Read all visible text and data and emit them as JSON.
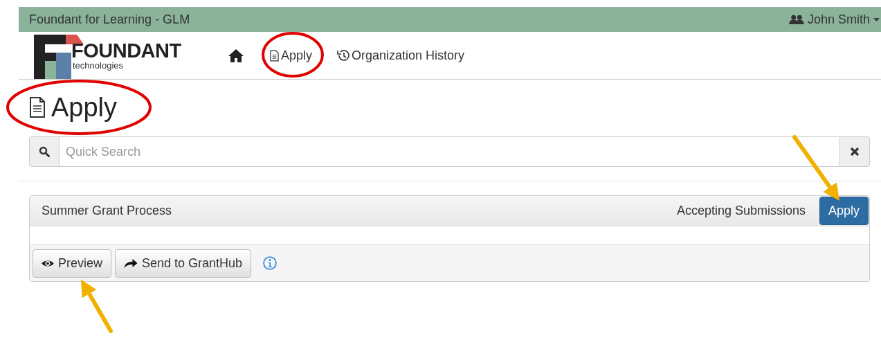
{
  "app_bar": {
    "title": "Foundant for Learning - GLM",
    "user": "John Smith"
  },
  "logo": {
    "name": "FOUNDANT",
    "tagline": "technologies"
  },
  "nav": [
    {
      "kind": "home"
    },
    {
      "kind": "document",
      "label": "Apply"
    },
    {
      "kind": "history",
      "label": "Organization History"
    }
  ],
  "page_title": "Apply",
  "search": {
    "placeholder": "Quick Search"
  },
  "processes": [
    {
      "name": "Summer Grant Process",
      "status": "Accepting Submissions",
      "action": "Apply",
      "buttons": [
        {
          "kind": "preview",
          "label": "Preview"
        },
        {
          "kind": "send",
          "label": "Send to GrantHub"
        }
      ]
    }
  ]
}
